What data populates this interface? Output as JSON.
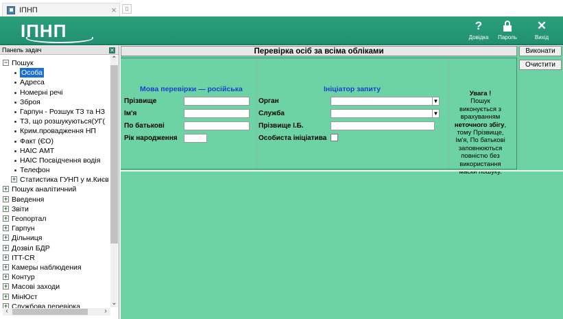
{
  "tab": {
    "title": "ІПНП",
    "close": "×"
  },
  "header": {
    "logo": "ІПНП",
    "buttons": [
      {
        "glyph": "?",
        "label": "Довідка"
      },
      {
        "glyph": "lock",
        "label": "Пароль"
      },
      {
        "glyph": "✕",
        "label": "Вихід"
      }
    ]
  },
  "panel": {
    "title": "Панель задач",
    "close_glyph": "✕",
    "tree": [
      {
        "label": "Пошук",
        "level": 0,
        "kind": "minus"
      },
      {
        "label": "Особа",
        "level": 1,
        "kind": "bullet",
        "selected": true
      },
      {
        "label": "Адреса",
        "level": 1,
        "kind": "bullet"
      },
      {
        "label": "Номерні речі",
        "level": 1,
        "kind": "bullet"
      },
      {
        "label": "Зброя",
        "level": 1,
        "kind": "bullet"
      },
      {
        "label": "Гарпун - Розшук ТЗ та НЗ",
        "level": 1,
        "kind": "bullet"
      },
      {
        "label": "ТЗ, що розшукуються(УГ(",
        "level": 1,
        "kind": "bullet"
      },
      {
        "label": "Крим.провадження НП",
        "level": 1,
        "kind": "bullet"
      },
      {
        "label": "Факт (ЄО)",
        "level": 1,
        "kind": "bullet"
      },
      {
        "label": "НАІС АМТ",
        "level": 1,
        "kind": "bullet"
      },
      {
        "label": "НАІС Посвідчення водія",
        "level": 1,
        "kind": "bullet"
      },
      {
        "label": "Телефон",
        "level": 1,
        "kind": "bullet"
      },
      {
        "label": "Статистика ГУНП у м.Києв",
        "level": 1,
        "kind": "plus"
      },
      {
        "label": "Пошук аналітичний",
        "level": 0,
        "kind": "plus"
      },
      {
        "label": "Введення",
        "level": 0,
        "kind": "plus"
      },
      {
        "label": "Звіти",
        "level": 0,
        "kind": "plus"
      },
      {
        "label": "Геопортал",
        "level": 0,
        "kind": "plus"
      },
      {
        "label": "Гарпун",
        "level": 0,
        "kind": "plus"
      },
      {
        "label": "Дільниця",
        "level": 0,
        "kind": "plus"
      },
      {
        "label": "Дозвіл БДР",
        "level": 0,
        "kind": "plus"
      },
      {
        "label": "ITT-CR",
        "level": 0,
        "kind": "plus"
      },
      {
        "label": "Камеры наблюдения",
        "level": 0,
        "kind": "plus"
      },
      {
        "label": "Контур",
        "level": 0,
        "kind": "plus"
      },
      {
        "label": "Масові заходи",
        "level": 0,
        "kind": "plus"
      },
      {
        "label": "МінЮст",
        "level": 0,
        "kind": "plus"
      },
      {
        "label": "Службова перевірка",
        "level": 0,
        "kind": "plus"
      }
    ]
  },
  "main": {
    "title": "Перевірка осіб за всіма обліками",
    "lang_section": {
      "title": "Мова перевірки — російська",
      "fields": [
        {
          "label": "Прізвище",
          "value": ""
        },
        {
          "label": "Ім'я",
          "value": ""
        },
        {
          "label": "По батькові",
          "value": ""
        },
        {
          "label": "Рік народження",
          "value": ""
        }
      ]
    },
    "initiator_section": {
      "title": "Ініціатор запиту",
      "fields": [
        {
          "label": "Орган",
          "value": "",
          "type": "select"
        },
        {
          "label": "Служба",
          "value": "",
          "type": "select"
        },
        {
          "label": "Прізвище І.Б.",
          "value": "",
          "type": "text"
        },
        {
          "label": "Особиста ініціатива",
          "checked": false,
          "type": "checkbox"
        }
      ]
    },
    "warning": {
      "title": "Увага !",
      "part1": "Пошук виконується з врахуванням",
      "bold": "неточного збігу",
      "part2": ", тому Прізвище, Ім'я, По батькові заповнюються повністю без використання маски пошуку."
    },
    "actions": {
      "execute": "Виконати",
      "clear": "Очистити"
    }
  },
  "colors": {
    "header": "#229070",
    "main_bg": "#6dd3a4",
    "section_title": "#1a3fd0",
    "selection": "#1a6fd6"
  }
}
